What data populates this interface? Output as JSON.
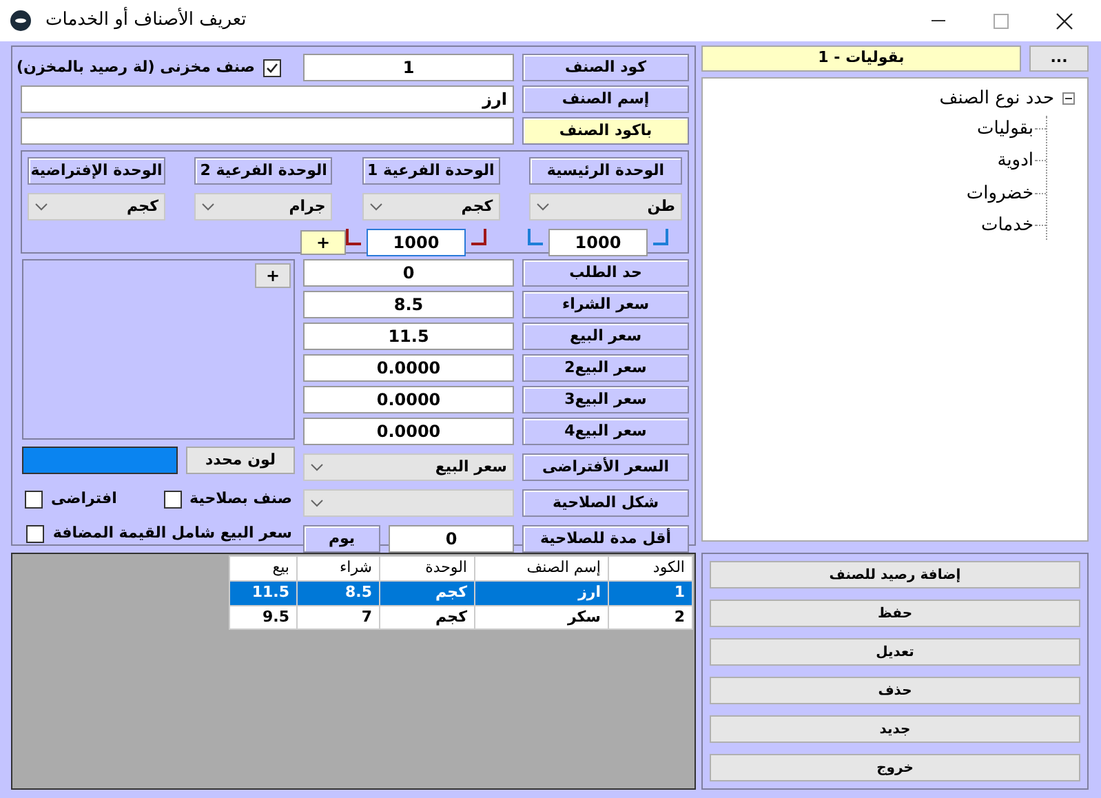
{
  "window": {
    "title": "تعريف الأصناف أو الخدمات"
  },
  "item": {
    "code_label": "كود الصنف",
    "code": "1",
    "stock_item": {
      "label": "صنف مخزنى (لة رصيد بالمخزن)",
      "checked": true
    },
    "name_label": "إسم الصنف",
    "name": "ارز",
    "barcode_label": "باكود الصنف"
  },
  "units": [
    {
      "label": "الوحدة الرئيسية",
      "value": "طن"
    },
    {
      "label": "الوحدة الفرعية 1",
      "value": "كجم"
    },
    {
      "label": "الوحدة الفرعية 2",
      "value": "جرام"
    },
    {
      "label": "الوحدة الإفتراضية",
      "value": "كجم"
    }
  ],
  "conversions": [
    {
      "value": "1000",
      "color": "#1e7fd8",
      "focused": false
    },
    {
      "value": "1000",
      "color": "#a01818",
      "focused": true
    }
  ],
  "add_unit_button": "+",
  "prices": [
    {
      "label": "حد الطلب",
      "value": "0"
    },
    {
      "label": "سعر الشراء",
      "value": "8.5"
    },
    {
      "label": "سعر البيع",
      "value": "11.5"
    },
    {
      "label": "سعر البيع2",
      "value": "0.0000"
    },
    {
      "label": "سعر البيع3",
      "value": "0.0000"
    },
    {
      "label": "سعر البيع4",
      "value": "0.0000"
    }
  ],
  "image_add_button": "+",
  "default_price": {
    "label": "السعر الأفتراضى",
    "value": "سعر البيع"
  },
  "color": {
    "button": "لون محدد",
    "color": "#0a84f0"
  },
  "expiry_shape": {
    "label": "شكل الصلاحية"
  },
  "min_expiry": {
    "label": "أقل مدة للصلاحية",
    "value": "0",
    "unit": "يوم"
  },
  "checks": [
    {
      "label": "صنف بصلاحية",
      "checked": false
    },
    {
      "label": "افتراضى",
      "checked": false
    },
    {
      "label": "سعر البيع شامل القيمة المضافة",
      "checked": false
    }
  ],
  "category": {
    "value": "1 - بقوليات",
    "browse": "..."
  },
  "tree": {
    "label": "حدد نوع الصنف",
    "expanded": true,
    "children": [
      {
        "label": "بقوليات"
      },
      {
        "label": "ادوية"
      },
      {
        "label": "خضروات"
      },
      {
        "label": "خدمات"
      }
    ]
  },
  "table": {
    "columns": [
      "الكود",
      "إسم الصنف",
      "الوحدة",
      "شراء",
      "بيع"
    ],
    "rows": [
      {
        "cells": [
          "1",
          "ارز",
          "كجم",
          "8.5",
          "11.5"
        ],
        "selected": true
      },
      {
        "cells": [
          "2",
          "سكر",
          "كجم",
          "7",
          "9.5"
        ],
        "selected": false
      }
    ]
  },
  "buttons": [
    "إضافة رصيد للصنف",
    "حفظ",
    "تعديل",
    "حذف",
    "جديد",
    "خروج"
  ]
}
